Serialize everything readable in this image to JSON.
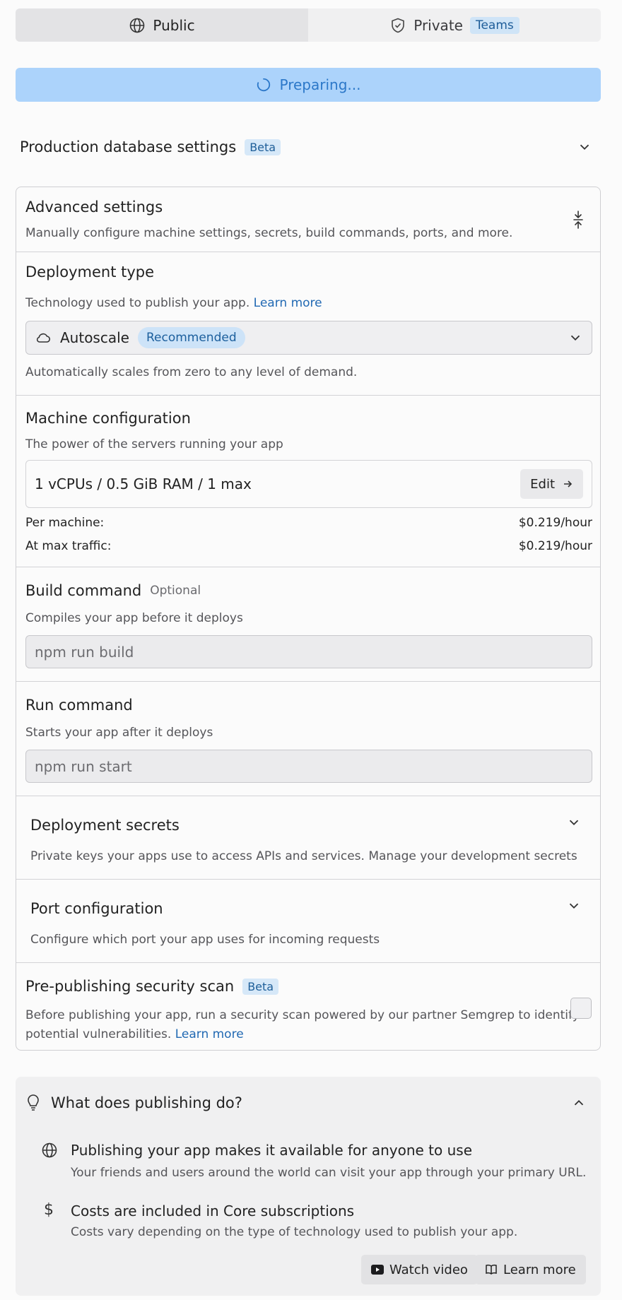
{
  "visibility": {
    "public_label": "Public",
    "private_label": "Private",
    "teams_badge": "Teams",
    "selected": "Public"
  },
  "publish_button": {
    "label": "Preparing..."
  },
  "production_db": {
    "title": "Production database settings",
    "badge": "Beta"
  },
  "advanced": {
    "title": "Advanced settings",
    "subtitle": "Manually configure machine settings, secrets, build commands, ports, and more.",
    "deployment_type": {
      "title": "Deployment type",
      "subtitle": "Technology used to publish your app.",
      "learn_more": "Learn more",
      "selected_value": "Autoscale",
      "recommended_badge": "Recommended",
      "description": "Automatically scales from zero to any level of demand."
    },
    "machine": {
      "title": "Machine configuration",
      "subtitle": "The power of the servers running your app",
      "value": "1 vCPUs / 0.5 GiB RAM / 1 max",
      "edit_label": "Edit",
      "per_machine_label": "Per machine:",
      "per_machine_price": "$0.219/hour",
      "max_traffic_label": "At max traffic:",
      "max_traffic_price": "$0.219/hour"
    },
    "build": {
      "title": "Build command",
      "optional": "Optional",
      "subtitle": "Compiles your app before it deploys",
      "placeholder": "npm run build"
    },
    "run": {
      "title": "Run command",
      "subtitle": "Starts your app after it deploys",
      "placeholder": "npm run start"
    },
    "secrets": {
      "title": "Deployment secrets",
      "subtitle": "Private keys your apps use to access APIs and services. Manage your development secrets"
    },
    "ports": {
      "title": "Port configuration",
      "subtitle": "Configure which port your app uses for incoming requests"
    },
    "security_scan": {
      "title": "Pre-publishing security scan",
      "badge": "Beta",
      "description_line1": "Before publishing your app, run a security scan powered by our partner Semgrep to identify",
      "description_line2": "potential vulnerabilities.",
      "learn_more": "Learn more",
      "checked": false
    }
  },
  "publishing_info": {
    "title": "What does publishing do?",
    "items": [
      {
        "icon": "globe-icon",
        "title": "Publishing your app makes it available for anyone to use",
        "subtitle": "Your friends and users around the world can visit your app through your primary URL."
      },
      {
        "icon": "dollar-icon",
        "title": "Costs are included in Core subscriptions",
        "subtitle": "Costs vary depending on the type of technology used to publish your app."
      }
    ],
    "watch_video": "Watch video",
    "learn_more": "Learn more"
  }
}
